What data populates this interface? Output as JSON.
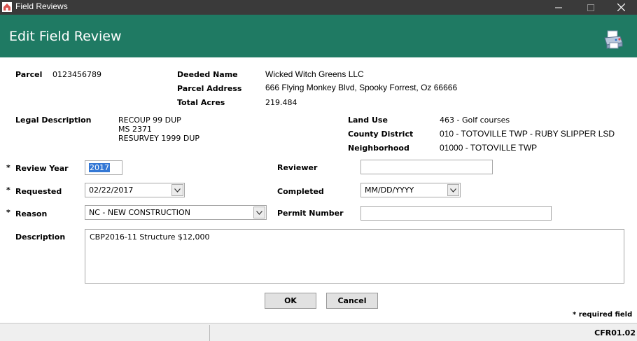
{
  "window": {
    "title": "Field Reviews"
  },
  "header": {
    "title": "Edit Field Review"
  },
  "parcel": {
    "parcel_label": "Parcel",
    "parcel_value": "0123456789",
    "deeded_name_label": "Deeded Name",
    "deeded_name_value": "Wicked Witch Greens LLC",
    "parcel_address_label": "Parcel Address",
    "parcel_address_value": "666 Flying Monkey Blvd, Spooky Forrest, Oz 66666",
    "total_acres_label": "Total Acres",
    "total_acres_value": "219.484",
    "legal_description_label": "Legal Description",
    "legal_description_lines": [
      "RECOUP 99 DUP",
      "MS 2371",
      "RESURVEY 1999 DUP"
    ],
    "land_use_label": "Land Use",
    "land_use_value": "463 - Golf courses",
    "county_district_label": "County District",
    "county_district_value": "010 -  TOTOVILLE TWP - RUBY SLIPPER LSD",
    "neighborhood_label": "Neighborhood",
    "neighborhood_value": "01000 - TOTOVILLE TWP"
  },
  "form": {
    "required_marker": "*",
    "review_year_label": "Review Year",
    "review_year_value": "2017",
    "reviewer_label": "Reviewer",
    "reviewer_value": "",
    "requested_label": "Requested",
    "requested_value": "02/22/2017",
    "completed_label": "Completed",
    "completed_value": "MM/DD/YYYY",
    "reason_label": "Reason",
    "reason_value": "NC - NEW CONSTRUCTION",
    "permit_number_label": "Permit Number",
    "permit_number_value": "",
    "description_label": "Description",
    "description_value": "CBP2016-11 Structure $12,000"
  },
  "buttons": {
    "ok": "OK",
    "cancel": "Cancel"
  },
  "footnote": "* required field",
  "status": {
    "code": "CFR01.02"
  },
  "colors": {
    "header_bg": "#1f7a63",
    "titlebar_bg": "#3a3a3a",
    "selection": "#3478d5"
  }
}
